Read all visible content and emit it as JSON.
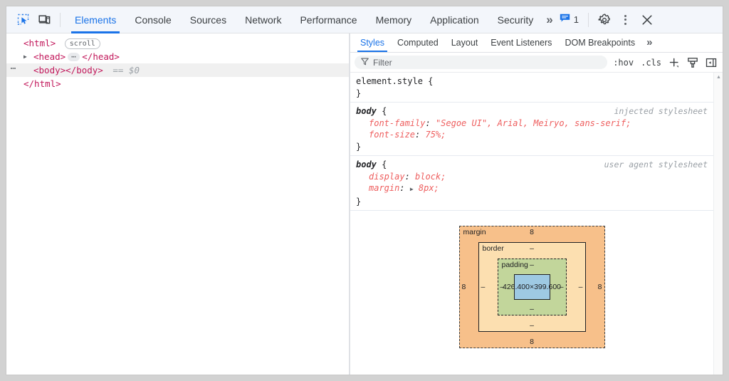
{
  "toolbar": {
    "inspect_icon": "inspect-element-icon",
    "device_icon": "device-toolbar-icon",
    "tabs": [
      {
        "label": "Elements",
        "active": true
      },
      {
        "label": "Console",
        "active": false
      },
      {
        "label": "Sources",
        "active": false
      },
      {
        "label": "Network",
        "active": false
      },
      {
        "label": "Performance",
        "active": false
      },
      {
        "label": "Memory",
        "active": false
      },
      {
        "label": "Application",
        "active": false
      },
      {
        "label": "Security",
        "active": false
      }
    ],
    "more_tabs": "»",
    "issues_count": "1",
    "settings_icon": "gear-icon",
    "menu_icon": "kebab-menu-icon",
    "close_icon": "close-icon",
    "accent_color": "#1a73e8"
  },
  "dom": {
    "rows": [
      {
        "indent": 0,
        "arrow": "",
        "text_before": "<html>",
        "pill": "scroll",
        "text_after": "",
        "selected": false,
        "badge": ""
      },
      {
        "indent": 1,
        "arrow": "▶",
        "text_before": "<head>",
        "pill": "",
        "text_after": "</head>",
        "selected": false,
        "badge": "",
        "dots": true
      },
      {
        "indent": 1,
        "arrow": "",
        "text_before": "<body></body>",
        "pill": "",
        "text_after": "",
        "selected": true,
        "badge": "⋯",
        "ref": "== $0"
      },
      {
        "indent": 0,
        "arrow": "",
        "text_before": "</html>",
        "pill": "",
        "text_after": "",
        "selected": false,
        "badge": ""
      }
    ]
  },
  "styles": {
    "tabs": [
      {
        "label": "Styles",
        "active": true
      },
      {
        "label": "Computed",
        "active": false
      },
      {
        "label": "Layout",
        "active": false
      },
      {
        "label": "Event Listeners",
        "active": false
      },
      {
        "label": "DOM Breakpoints",
        "active": false
      }
    ],
    "more_tabs": "»",
    "filter": {
      "placeholder": "Filter",
      "icon": "filter-funnel-icon",
      "hov_label": ":hov",
      "cls_label": ".cls",
      "new_rule_icon": "plus-icon",
      "element_state_icon": "paintbrush-icon",
      "sidebar_toggle_icon": "computed-sidebar-icon"
    },
    "rules": [
      {
        "selector": "element.style",
        "selector_italic": false,
        "origin": "",
        "declarations": []
      },
      {
        "selector": "body",
        "selector_italic": true,
        "origin": "injected stylesheet",
        "declarations": [
          {
            "prop": "font-family",
            "value": "\"Segoe UI\", Arial, Meiryo, sans-serif;",
            "expander": false
          },
          {
            "prop": "font-size",
            "value": "75%;",
            "expander": false
          }
        ]
      },
      {
        "selector": "body",
        "selector_italic": true,
        "origin": "user agent stylesheet",
        "declarations": [
          {
            "prop": "display",
            "value": "block;",
            "expander": false
          },
          {
            "prop": "margin",
            "value": "8px;",
            "expander": true
          }
        ]
      }
    ],
    "box_model": {
      "margin_label": "margin",
      "margin_top": "8",
      "margin_right": "8",
      "margin_bottom": "8",
      "margin_left": "8",
      "border_label": "border",
      "border_top": "–",
      "border_right": "–",
      "border_bottom": "–",
      "border_left": "–",
      "padding_label": "padding",
      "padding_top": "–",
      "padding_right": "–",
      "padding_bottom": "–",
      "padding_left": "–",
      "content_size": "426.400×399.600",
      "colors": {
        "margin": "#f7c08a",
        "border": "#fcdfb0",
        "padding": "#c2d69b",
        "content": "#9ec9e3"
      }
    }
  }
}
